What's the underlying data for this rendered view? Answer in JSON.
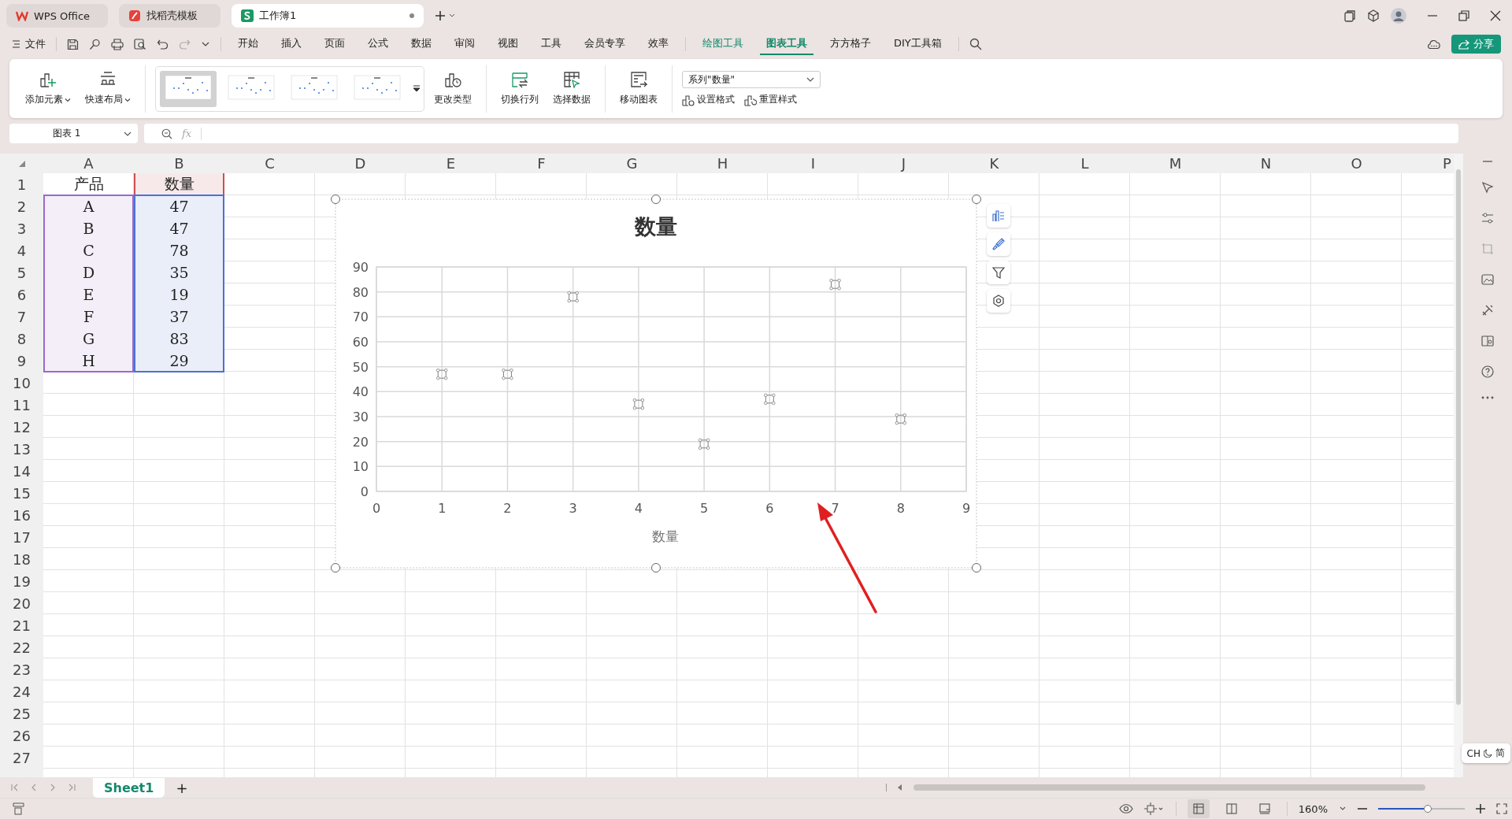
{
  "tabs": [
    {
      "label": "WPS Office",
      "kind": "wps",
      "selected": false
    },
    {
      "label": "找稻壳模板",
      "kind": "docer",
      "selected": false
    },
    {
      "label": "工作簿1",
      "kind": "sheet",
      "selected": true
    }
  ],
  "file_menu": "文件",
  "menu": [
    {
      "label": "开始",
      "kind": "main",
      "selected": false
    },
    {
      "label": "插入",
      "kind": "main",
      "selected": false
    },
    {
      "label": "页面",
      "kind": "main",
      "selected": false
    },
    {
      "label": "公式",
      "kind": "main",
      "selected": false
    },
    {
      "label": "数据",
      "kind": "main",
      "selected": false
    },
    {
      "label": "审阅",
      "kind": "main",
      "selected": false
    },
    {
      "label": "视图",
      "kind": "main",
      "selected": false
    },
    {
      "label": "工具",
      "kind": "main",
      "selected": false
    },
    {
      "label": "会员专享",
      "kind": "main",
      "selected": false
    },
    {
      "label": "效率",
      "kind": "main",
      "selected": false
    },
    {
      "label": "绘图工具",
      "kind": "context",
      "selected": false
    },
    {
      "label": "图表工具",
      "kind": "context",
      "selected": true
    },
    {
      "label": "方方格子",
      "kind": "main",
      "selected": false
    },
    {
      "label": "DIY工具箱",
      "kind": "main",
      "selected": false
    }
  ],
  "share_button": "分享",
  "ribbon": {
    "add_element": "添加元素",
    "quick_layout": "快速布局",
    "styles": [
      {
        "selected": true
      },
      {
        "selected": false
      },
      {
        "selected": false
      },
      {
        "selected": false
      }
    ],
    "buttons": [
      {
        "label": "更改类型",
        "kind": "change"
      },
      {
        "label": "切换行列",
        "kind": "switch"
      },
      {
        "label": "选择数据",
        "kind": "select"
      },
      {
        "label": "移动图表",
        "kind": "move"
      }
    ],
    "series_dropdown": "系列\"数量\"",
    "format_button": "设置格式",
    "reset_button": "重置样式"
  },
  "name_box": "图表 1",
  "fx": "fx",
  "sheet": {
    "columns": [
      "A",
      "B",
      "C",
      "D",
      "E",
      "F",
      "G",
      "H",
      "I",
      "J",
      "K",
      "L",
      "M",
      "N",
      "O",
      "P"
    ],
    "row_numbers": [
      "1",
      "2",
      "3",
      "4",
      "5",
      "6",
      "7",
      "8",
      "9",
      "10",
      "11",
      "12",
      "13",
      "14",
      "15",
      "16",
      "17",
      "18",
      "19",
      "20",
      "21",
      "22",
      "23",
      "24",
      "25",
      "26",
      "27"
    ],
    "rows": [
      [
        "产品",
        "数量"
      ],
      [
        "A",
        "47"
      ],
      [
        "B",
        "47"
      ],
      [
        "C",
        "78"
      ],
      [
        "D",
        "35"
      ],
      [
        "E",
        "19"
      ],
      [
        "F",
        "37"
      ],
      [
        "G",
        "83"
      ],
      [
        "H",
        "29"
      ]
    ]
  },
  "chart": {
    "chart_data": {
      "type": "scatter",
      "title": "数量",
      "xlabel": "数量",
      "series": [
        {
          "color": "#808080",
          "values": [
            47,
            47,
            78,
            35,
            19,
            37,
            83,
            29
          ]
        }
      ],
      "grid": true,
      "x": [
        1,
        2,
        3,
        4,
        5,
        6,
        7,
        8
      ],
      "xlim": [
        0,
        9
      ],
      "ylim": [
        0,
        90
      ],
      "xticks": [
        0,
        1,
        2,
        3,
        4,
        5,
        6,
        7,
        8,
        9
      ],
      "yticks": [
        0,
        10,
        20,
        30,
        40,
        50,
        60,
        70,
        80,
        90
      ]
    }
  },
  "sheet_tabs": [
    {
      "label": "Sheet1",
      "selected": true
    }
  ],
  "add_sheet": "+",
  "ime": {
    "lang": "CH",
    "mode": "简"
  },
  "status_bar": {
    "zoom": "160%",
    "zoom_slider": {
      "level": 0.57
    },
    "views": [
      {
        "kind": "normal",
        "selected": true
      },
      {
        "kind": "split",
        "selected": false
      },
      {
        "kind": "page",
        "selected": false
      }
    ]
  }
}
